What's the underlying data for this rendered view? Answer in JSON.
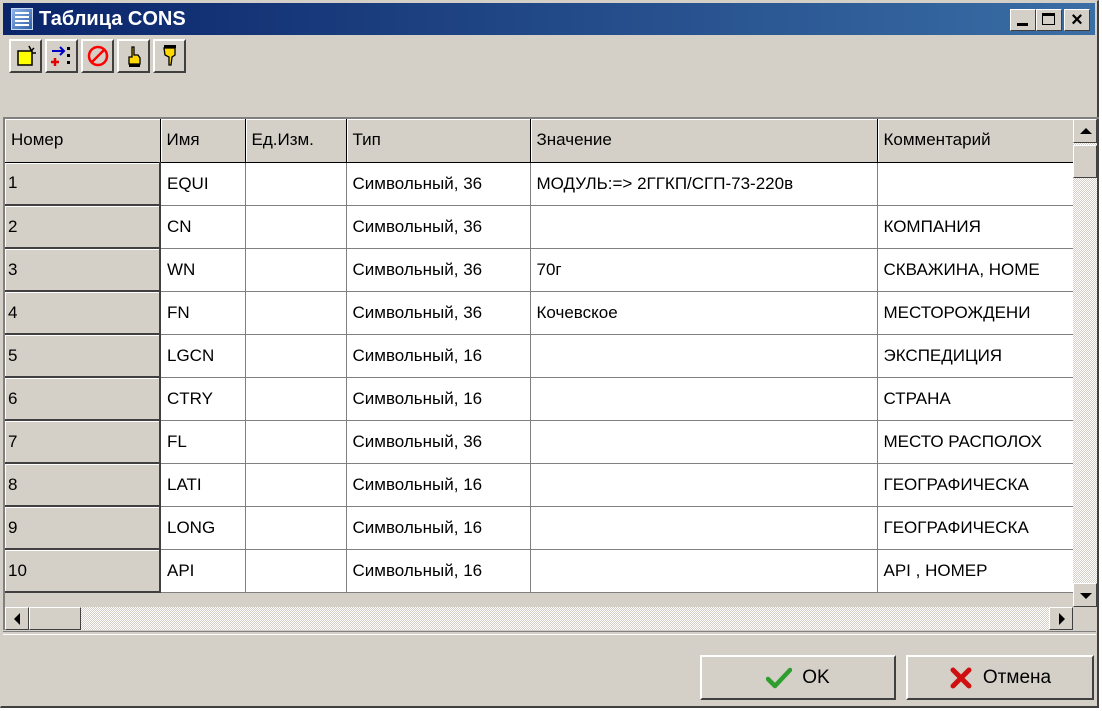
{
  "window": {
    "title": "Таблица CONS",
    "caption_buttons": {
      "minimize": "minimize-icon",
      "maximize": "maximize-icon",
      "close": "×"
    }
  },
  "toolbar": {
    "buttons": [
      {
        "icon": "new-row-icon"
      },
      {
        "icon": "insert-row-icon"
      },
      {
        "icon": "delete-icon"
      },
      {
        "icon": "hand-up-icon"
      },
      {
        "icon": "hand-down-icon"
      }
    ]
  },
  "table": {
    "columns": [
      "Номер",
      "Имя",
      "Ед.Изм.",
      "Тип",
      "Значение",
      "Комментарий"
    ],
    "rows": [
      [
        "1",
        "EQUI",
        "",
        "Символьный, 36",
        "МОДУЛЬ:=> 2ГГКП/СГП-73-220в",
        ""
      ],
      [
        "2",
        "CN",
        "",
        "Символьный, 36",
        "",
        "КОМПАНИЯ"
      ],
      [
        "3",
        "WN",
        "",
        "Символьный, 36",
        "70г",
        "СКВАЖИНА, НОМЕ"
      ],
      [
        "4",
        "FN",
        "",
        "Символьный, 36",
        "Кочевское",
        "МЕСТОРОЖДЕНИ"
      ],
      [
        "5",
        "LGCN",
        "",
        "Символьный, 16",
        "",
        "ЭКСПЕДИЦИЯ"
      ],
      [
        "6",
        "CTRY",
        "",
        "Символьный, 16",
        "",
        "СТРАНА"
      ],
      [
        "7",
        "FL",
        "",
        "Символьный, 36",
        "",
        "МЕСТО РАСПОЛОХ"
      ],
      [
        "8",
        "LATI",
        "",
        "Символьный, 16",
        "",
        "ГЕОГРАФИЧЕСКА"
      ],
      [
        "9",
        "LONG",
        "",
        "Символьный, 16",
        "",
        "ГЕОГРАФИЧЕСКА"
      ],
      [
        "10",
        "API",
        "",
        "Символьный, 16",
        "",
        "API , НОМЕР"
      ]
    ]
  },
  "buttons": {
    "ok_label": "OK",
    "cancel_label": "Отмена"
  },
  "colors": {
    "titlebar_start": "#0a246a",
    "titlebar_end": "#3a6ea5",
    "face": "#d4d0c8",
    "ok_check": "#2e9e2e",
    "cancel_x": "#d01010"
  }
}
